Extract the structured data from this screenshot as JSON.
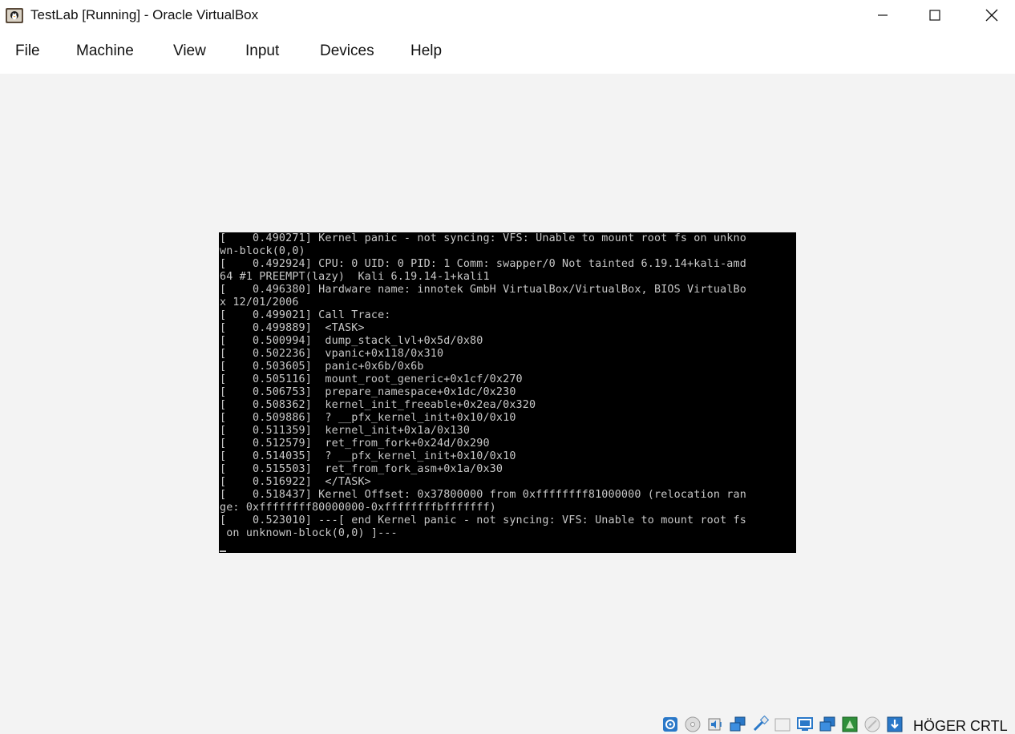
{
  "window": {
    "title": "TestLab [Running] - Oracle VirtualBox",
    "icon": "virtualbox-app-icon",
    "controls": [
      "minimize-icon",
      "maximize-icon",
      "close-icon"
    ]
  },
  "menu": {
    "items": [
      "File",
      "Machine",
      "View",
      "Input",
      "Devices",
      "Help"
    ]
  },
  "console": {
    "lines": [
      "[    0.490271] Kernel panic - not syncing: VFS: Unable to mount root fs on unkno",
      "wn-block(0,0)",
      "[    0.492924] CPU: 0 UID: 0 PID: 1 Comm: swapper/0 Not tainted 6.19.14+kali-amd",
      "64 #1 PREEMPT(lazy)  Kali 6.19.14-1+kali1",
      "[    0.496380] Hardware name: innotek GmbH VirtualBox/VirtualBox, BIOS VirtualBo",
      "x 12/01/2006",
      "[    0.499021] Call Trace:",
      "[    0.499889]  <TASK>",
      "[    0.500994]  dump_stack_lvl+0x5d/0x80",
      "[    0.502236]  vpanic+0x118/0x310",
      "[    0.503605]  panic+0x6b/0x6b",
      "[    0.505116]  mount_root_generic+0x1cf/0x270",
      "[    0.506753]  prepare_namespace+0x1dc/0x230",
      "[    0.508362]  kernel_init_freeable+0x2ea/0x320",
      "[    0.509886]  ? __pfx_kernel_init+0x10/0x10",
      "[    0.511359]  kernel_init+0x1a/0x130",
      "[    0.512579]  ret_from_fork+0x24d/0x290",
      "[    0.514035]  ? __pfx_kernel_init+0x10/0x10",
      "[    0.515503]  ret_from_fork_asm+0x1a/0x30",
      "[    0.516922]  </TASK>",
      "[    0.518437] Kernel Offset: 0x37800000 from 0xffffffff81000000 (relocation ran",
      "ge: 0xffffffff80000000-0xffffffffbfffffff)",
      "[    0.523010] ---[ end Kernel panic - not syncing: VFS: Unable to mount root fs",
      " on unknown-block(0,0) ]---"
    ]
  },
  "statusbar": {
    "icons": [
      "hard-disk-icon",
      "optical-drive-icon",
      "audio-icon",
      "network-icon",
      "usb-icon",
      "shared-folders-icon",
      "display-icon",
      "recording-icon",
      "cpu-icon",
      "mouse-integration-icon",
      "keyboard-capture-icon"
    ],
    "host_key": "HÖGER CRTL"
  },
  "colors": {
    "chrome": "#ffffff",
    "background": "#f3f3f3",
    "console_bg": "#000000",
    "console_fg": "#c8c8c8"
  }
}
